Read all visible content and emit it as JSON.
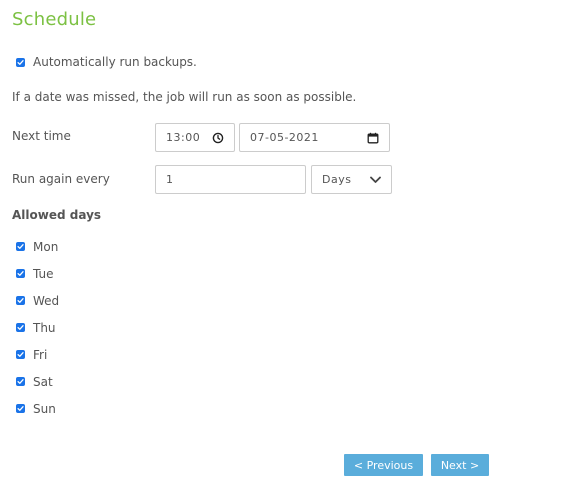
{
  "title": "Schedule",
  "auto_backup": {
    "checked": true,
    "label": "Automatically run backups."
  },
  "missed_info": "If a date was missed, the job will run as soon as possible.",
  "next_time": {
    "label": "Next time",
    "time_value": "13:00",
    "date_value": "07-05-2021",
    "time_icon": "clock-icon",
    "date_icon": "calendar-icon"
  },
  "run_again": {
    "label": "Run again every",
    "interval_value": "1",
    "unit_selected": "Days",
    "unit_icon": "chevron-down-icon"
  },
  "allowed_days": {
    "title": "Allowed days",
    "days": [
      {
        "label": "Mon",
        "checked": true
      },
      {
        "label": "Tue",
        "checked": true
      },
      {
        "label": "Wed",
        "checked": true
      },
      {
        "label": "Thu",
        "checked": true
      },
      {
        "label": "Fri",
        "checked": true
      },
      {
        "label": "Sat",
        "checked": true
      },
      {
        "label": "Sun",
        "checked": true
      }
    ]
  },
  "footer": {
    "previous_label": "< Previous",
    "next_label": "Next >"
  },
  "colors": {
    "title": "#7cc143",
    "checkbox": "#1a73e8",
    "button": "#5aaddb",
    "text": "#555555",
    "border": "#cccccc"
  }
}
